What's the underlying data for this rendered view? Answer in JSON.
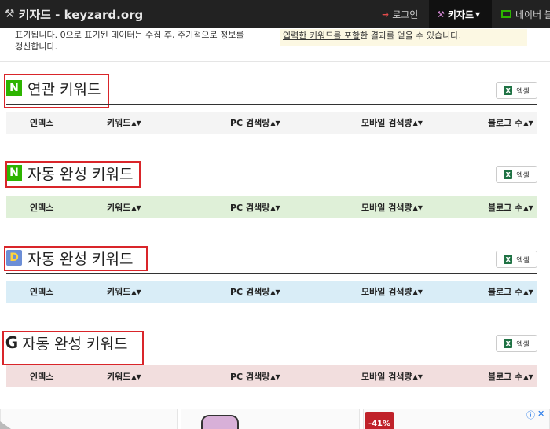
{
  "navbar": {
    "brand": "키자드 - keyzard.org",
    "login": "로그인",
    "keyword_menu": "키자드",
    "naver": "네이버 블"
  },
  "info": {
    "left_line1": "표기됩니다. 0으로 표기된 데이터는 수집 후, 주기적으로 정보를",
    "left_line2": "갱신합니다.",
    "right_underlined": "입력한 키워드를 포함",
    "right_rest": "한 결과를 얻을 수 있습니다."
  },
  "sections": [
    {
      "logo": "N",
      "title": "연관 키워드",
      "excel": "엑셀",
      "header_bg": "#f4f4f4",
      "columns": [
        "인덱스",
        "키워드",
        "PC 검색량",
        "모바일 검색량",
        "블로그 수"
      ]
    },
    {
      "logo": "N",
      "title": "자동 완성 키워드",
      "excel": "엑셀",
      "header_bg": "#dff0d8",
      "columns": [
        "인덱스",
        "키워드",
        "PC 검색량",
        "모바일 검색량",
        "블로그 수"
      ]
    },
    {
      "logo": "D",
      "title": "자동 완성 키워드",
      "excel": "엑셀",
      "header_bg": "#d9edf7",
      "columns": [
        "인덱스",
        "키워드",
        "PC 검색량",
        "모바일 검색량",
        "블로그 수"
      ]
    },
    {
      "logo": "G",
      "title": "자동 완성 키워드",
      "excel": "엑셀",
      "header_bg": "#f2dede",
      "columns": [
        "인덱스",
        "키워드",
        "PC 검색량",
        "모바일 검색량",
        "블로그 수"
      ]
    }
  ],
  "ad": {
    "discount": "-41%"
  },
  "icons": {
    "brand": "magic-wand-icon",
    "login": "sign-in-icon",
    "naver": "naver-blog-icon",
    "excel": "excel-icon",
    "sort": "sort-icon",
    "ad_info": "ad-choices-icon",
    "ad_close": "close-icon"
  }
}
